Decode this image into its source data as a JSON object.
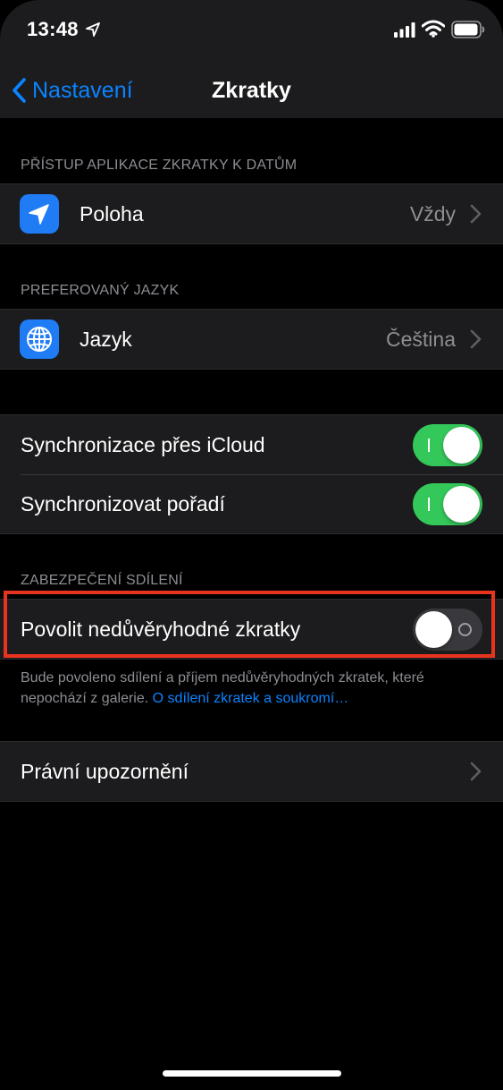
{
  "status_bar": {
    "time": "13:48",
    "icons": [
      "location-arrow-icon",
      "signal-icon",
      "wifi-icon",
      "battery-icon"
    ]
  },
  "nav": {
    "back_label": "Nastavení",
    "title": "Zkratky"
  },
  "sections": {
    "data_access": {
      "header": "PŘÍSTUP APLIKACE ZKRATKY K DATŮM",
      "row": {
        "label": "Poloha",
        "value": "Vždy",
        "icon": "location-arrow-icon"
      }
    },
    "language": {
      "header": "PREFEROVANÝ JAZYK",
      "row": {
        "label": "Jazyk",
        "value": "Čeština",
        "icon": "globe-icon"
      }
    },
    "sync": {
      "rows": [
        {
          "label": "Synchronizace přes iCloud",
          "on": true
        },
        {
          "label": "Synchronizovat pořadí",
          "on": true
        }
      ]
    },
    "sharing_security": {
      "header": "ZABEZPEČENÍ SDÍLENÍ",
      "row": {
        "label": "Povolit nedůvěryhodné zkratky",
        "on": false
      },
      "footer_text": "Bude povoleno sdílení a příjem nedůvěryhodných zkratek, které nepochází z galerie. ",
      "footer_link": "O sdílení zkratek a soukromí…"
    },
    "legal": {
      "row": {
        "label": "Právní upozornění"
      }
    }
  },
  "colors": {
    "background": "#000000",
    "cell": "#1c1c1e",
    "accent": "#0a84ff",
    "toggle_on": "#34c759",
    "toggle_off": "#39393d",
    "secondary_text": "#8d8d93",
    "highlight": "#e8341e",
    "icon_tile": "#1f7cf5"
  }
}
